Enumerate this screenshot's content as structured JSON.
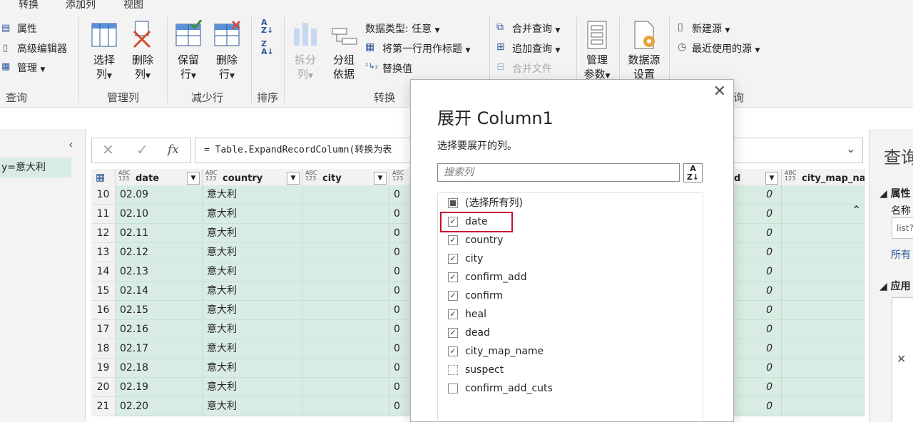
{
  "tabs": [
    "转换",
    "添加列",
    "视图"
  ],
  "ribbon": {
    "query_group": {
      "items": [
        "属性",
        "高级编辑器",
        "管理"
      ],
      "label": "查询"
    },
    "manage_cols": {
      "btn1": [
        "选择",
        "列"
      ],
      "btn2": [
        "删除",
        "列"
      ],
      "label": "管理列"
    },
    "reduce_rows": {
      "btn1": [
        "保留",
        "行"
      ],
      "btn2": [
        "删除",
        "行"
      ],
      "label": "减少行"
    },
    "sort": {
      "label": "排序"
    },
    "transform": {
      "split": [
        "拆分",
        "列"
      ],
      "group": [
        "分组",
        "依据"
      ],
      "datatype": "数据类型: 任意",
      "first_row": "将第一行用作标题",
      "replace": "替换值",
      "label": "转换"
    },
    "combine": {
      "merge": "合并查询",
      "append": "追加查询",
      "files": "合并文件"
    },
    "params": {
      "btn": [
        "管理",
        "参数"
      ]
    },
    "datasource": {
      "btn": [
        "数据源",
        "设置"
      ]
    },
    "newquery": {
      "new_source": "新建源",
      "recent": "最近使用的源",
      "label_partial": "询"
    }
  },
  "left_pane": {
    "item": "y=意大利"
  },
  "formula": {
    "text": "= Table.ExpandRecordColumn(转换为表"
  },
  "grid": {
    "columns": [
      {
        "type": "ABC\n123",
        "name": "date"
      },
      {
        "type": "ABC\n123",
        "name": "country"
      },
      {
        "type": "ABC\n123",
        "name": "city"
      },
      {
        "type": "ABC\n123",
        "name": ""
      },
      {
        "type": "",
        "name": "d"
      },
      {
        "type": "ABC\n123",
        "name": "city_map_nar"
      }
    ],
    "rows": [
      {
        "n": "10",
        "date": "02.09",
        "country": "意大利",
        "v": "0",
        "d": "0"
      },
      {
        "n": "11",
        "date": "02.10",
        "country": "意大利",
        "v": "0",
        "d": "0"
      },
      {
        "n": "12",
        "date": "02.11",
        "country": "意大利",
        "v": "0",
        "d": "0"
      },
      {
        "n": "13",
        "date": "02.12",
        "country": "意大利",
        "v": "0",
        "d": "0"
      },
      {
        "n": "14",
        "date": "02.13",
        "country": "意大利",
        "v": "0",
        "d": "0"
      },
      {
        "n": "15",
        "date": "02.14",
        "country": "意大利",
        "v": "0",
        "d": "0"
      },
      {
        "n": "16",
        "date": "02.15",
        "country": "意大利",
        "v": "0",
        "d": "0"
      },
      {
        "n": "17",
        "date": "02.16",
        "country": "意大利",
        "v": "0",
        "d": "0"
      },
      {
        "n": "18",
        "date": "02.17",
        "country": "意大利",
        "v": "0",
        "d": "0"
      },
      {
        "n": "19",
        "date": "02.18",
        "country": "意大利",
        "v": "0",
        "d": "0"
      },
      {
        "n": "20",
        "date": "02.19",
        "country": "意大利",
        "v": "0",
        "d": "0"
      },
      {
        "n": "21",
        "date": "02.20",
        "country": "意大利",
        "v": "0",
        "d": "0"
      }
    ]
  },
  "right_pane": {
    "title": "查询",
    "props_section": "◢ 属性",
    "name_label": "名称",
    "name_value": "list?",
    "all_props": "所有",
    "steps_section": "◢ 应用"
  },
  "modal": {
    "title": "展开 Column1",
    "subtitle": "选择要展开的列。",
    "search_placeholder": "搜索列",
    "sort_glyph": "A\nZ↓",
    "options": [
      {
        "label": "(选择所有列)",
        "state": "partial"
      },
      {
        "label": "date",
        "state": "checked"
      },
      {
        "label": "country",
        "state": "checked"
      },
      {
        "label": "city",
        "state": "checked"
      },
      {
        "label": "confirm_add",
        "state": "checked"
      },
      {
        "label": "confirm",
        "state": "checked"
      },
      {
        "label": "heal",
        "state": "checked"
      },
      {
        "label": "dead",
        "state": "checked"
      },
      {
        "label": "city_map_name",
        "state": "checked"
      },
      {
        "label": "suspect",
        "state": "unchecked"
      },
      {
        "label": "confirm_add_cuts",
        "state": "unchecked"
      }
    ]
  },
  "colors": {
    "accent_green": "#d9ece3",
    "highlight_red": "#c8102e",
    "ribbon_bg": "#f3f3f3"
  }
}
